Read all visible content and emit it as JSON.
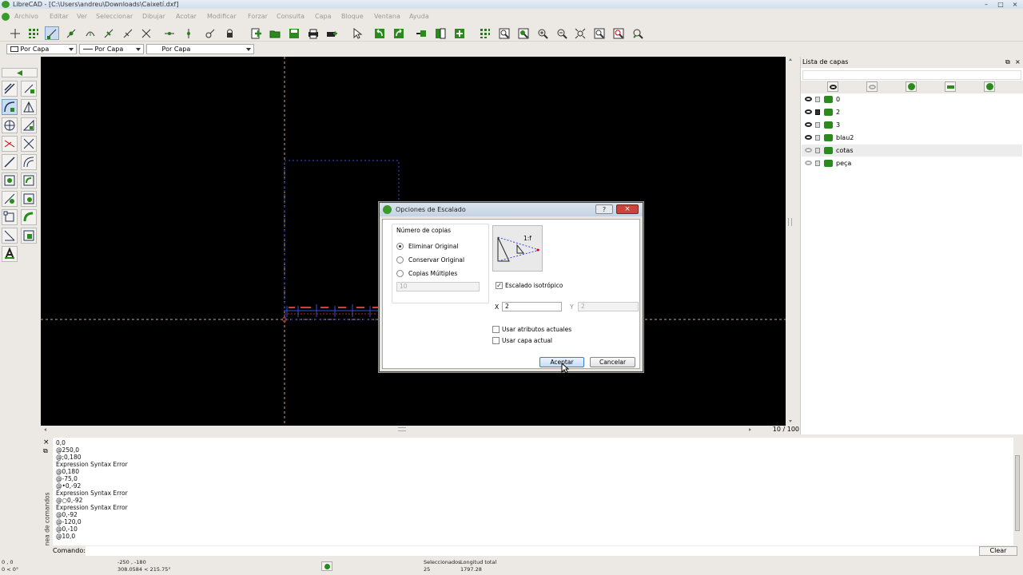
{
  "window": {
    "title": "LibreCAD - [C:\\Users\\andreu\\Downloads\\Caixetí.dxf]",
    "controls": {
      "minimize": "–",
      "maximize": "□",
      "close": "×"
    }
  },
  "menu": [
    "Archivo",
    "Editar",
    "Ver",
    "Seleccionar",
    "Dibujar",
    "Acotar",
    "Modificar",
    "Forzar",
    "Consulta",
    "Capa",
    "Bloque",
    "Ventana",
    "Ayuda"
  ],
  "pen_toolbar": {
    "color": "Por Capa",
    "linetype": "Por Capa",
    "width": "Por Capa"
  },
  "layer_list": {
    "title": "Lista de capas",
    "layers": [
      {
        "name": "0",
        "visible": true,
        "locked": false
      },
      {
        "name": "2",
        "visible": true,
        "locked": true
      },
      {
        "name": "3",
        "visible": true,
        "locked": false
      },
      {
        "name": "blau2",
        "visible": true,
        "locked": false
      },
      {
        "name": "cotas",
        "visible": false,
        "locked": false,
        "selected": true
      },
      {
        "name": "peça",
        "visible": false,
        "locked": false
      }
    ]
  },
  "canvas": {
    "page_indicator": "10 / 100"
  },
  "dialog": {
    "title": "Opciones de Escalado",
    "help": "?",
    "close": "×",
    "copies_group": "Número de copias",
    "options": [
      {
        "label": "Eliminar Original",
        "checked": true
      },
      {
        "label": "Conservar Original",
        "checked": false
      },
      {
        "label": "Copias Múltiples",
        "checked": false
      }
    ],
    "copies_value": "10",
    "preview_label": "1:f",
    "isotropic_label": "Escalado isotrópico",
    "isotropic_checked": true,
    "x_label": "X",
    "x_value": "2",
    "y_label": "Y",
    "y_value": "2",
    "use_current_attributes": "Usar atributos actuales",
    "use_current_layer": "Usar capa actual",
    "ok": "Aceptar",
    "cancel": "Cancelar"
  },
  "command": {
    "vertical_label": "Línea de comandos",
    "history": [
      "0,0",
      "@250,0",
      "@;0,180",
      "Expression Syntax Error",
      "@0,180",
      "@-75,0",
      "@•0,-92",
      "Expression Syntax Error",
      "@○0,-92",
      "Expression Syntax Error",
      "@0,-92",
      "@-120,0",
      "@0,-10",
      "@10,0"
    ],
    "prompt_label": "Comando:",
    "clear": "Clear"
  },
  "status": {
    "abs_coord": "0 , 0",
    "abs_polar": "0 < 0°",
    "rel_coord": "-250 , -180",
    "rel_polar": "308.0584 < 215.75°",
    "selected_label": "Seleccionados",
    "selected_value": "25",
    "length_label": "Longitud total",
    "length_value": "1797.28"
  }
}
